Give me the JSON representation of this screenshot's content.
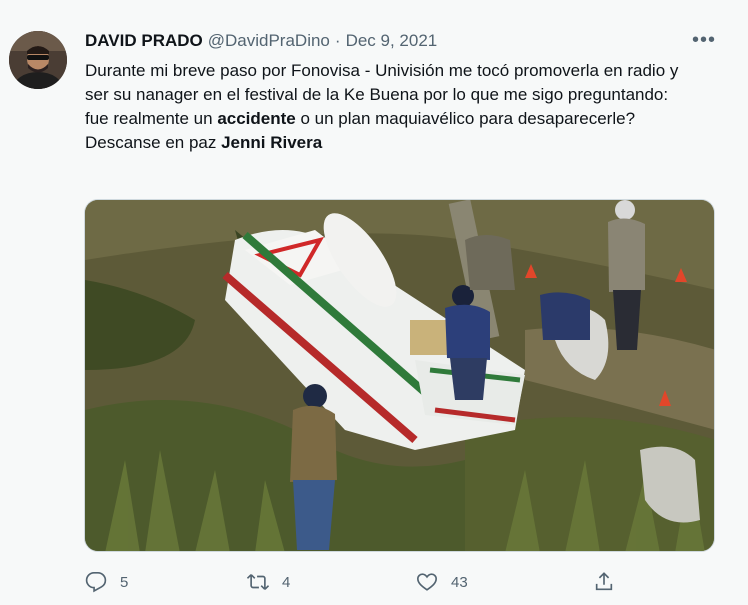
{
  "author": {
    "name": "DAVID PRADO",
    "handle": "@DavidPraDino",
    "separator": "·",
    "date": "Dec 9, 2021"
  },
  "more_menu": "•••",
  "tweet": {
    "text_part1": "Durante mi breve paso por Fonovisa - Univisión me tocó promoverla en radio y ser su nanager en el festival de la Ke Buena por lo que me sigo preguntando: fue realmente un ",
    "text_bold1": "accidente",
    "text_part2": " o un plan maquiavélico para desaparecerle?",
    "text_line2_prefix": "Descanse en paz ",
    "text_bold2": "Jenni Rivera"
  },
  "actions": {
    "reply_count": "5",
    "retweet_count": "4",
    "like_count": "43"
  },
  "icons": [
    "more-icon",
    "reply-icon",
    "retweet-icon",
    "like-icon",
    "share-icon"
  ],
  "colors": {
    "background": "#f7f9f9",
    "text": "#0f1419",
    "secondary": "#536471",
    "border": "#cfd9de"
  }
}
